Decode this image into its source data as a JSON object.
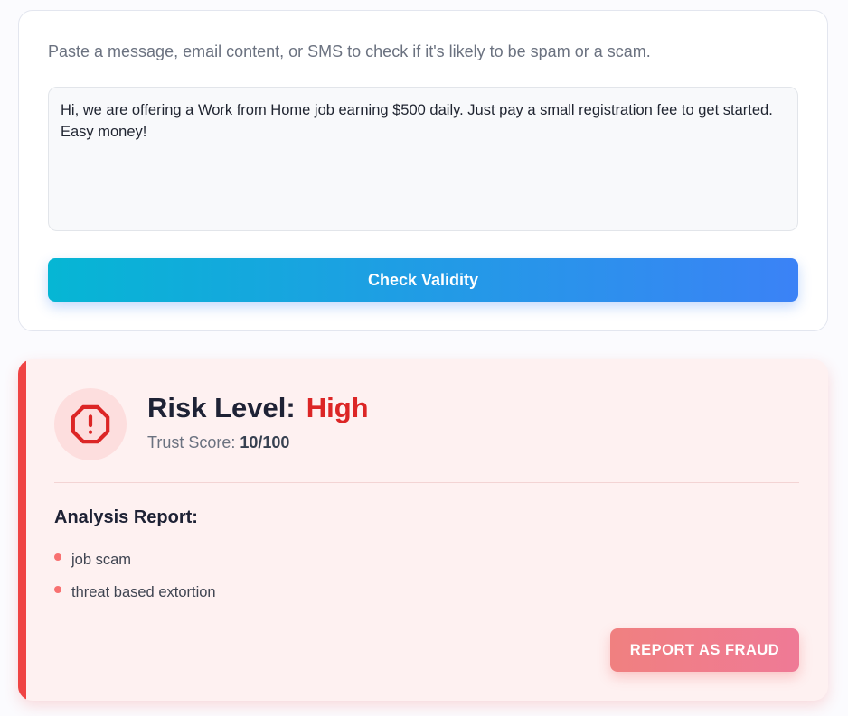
{
  "input": {
    "intro": "Paste a message, email content, or SMS to check if it's likely to be spam or a scam.",
    "message": "Hi, we are offering a Work from Home job earning $500 daily. Just pay a small registration fee to get started. Easy money!",
    "check_label": "Check Validity"
  },
  "result": {
    "icon": "alert-octagon-icon",
    "risk_label": "Risk Level:",
    "risk_value": "High",
    "trust_label": "Trust Score:",
    "trust_value": "10/100",
    "report_title": "Analysis Report:",
    "findings": [
      "job scam",
      "threat based extortion"
    ],
    "report_button": "REPORT AS FRAUD"
  },
  "colors": {
    "accent_red": "#ef4444",
    "risk_text": "#dc2626",
    "gradient_start": "#06b6d4",
    "gradient_end": "#3b82f6"
  }
}
